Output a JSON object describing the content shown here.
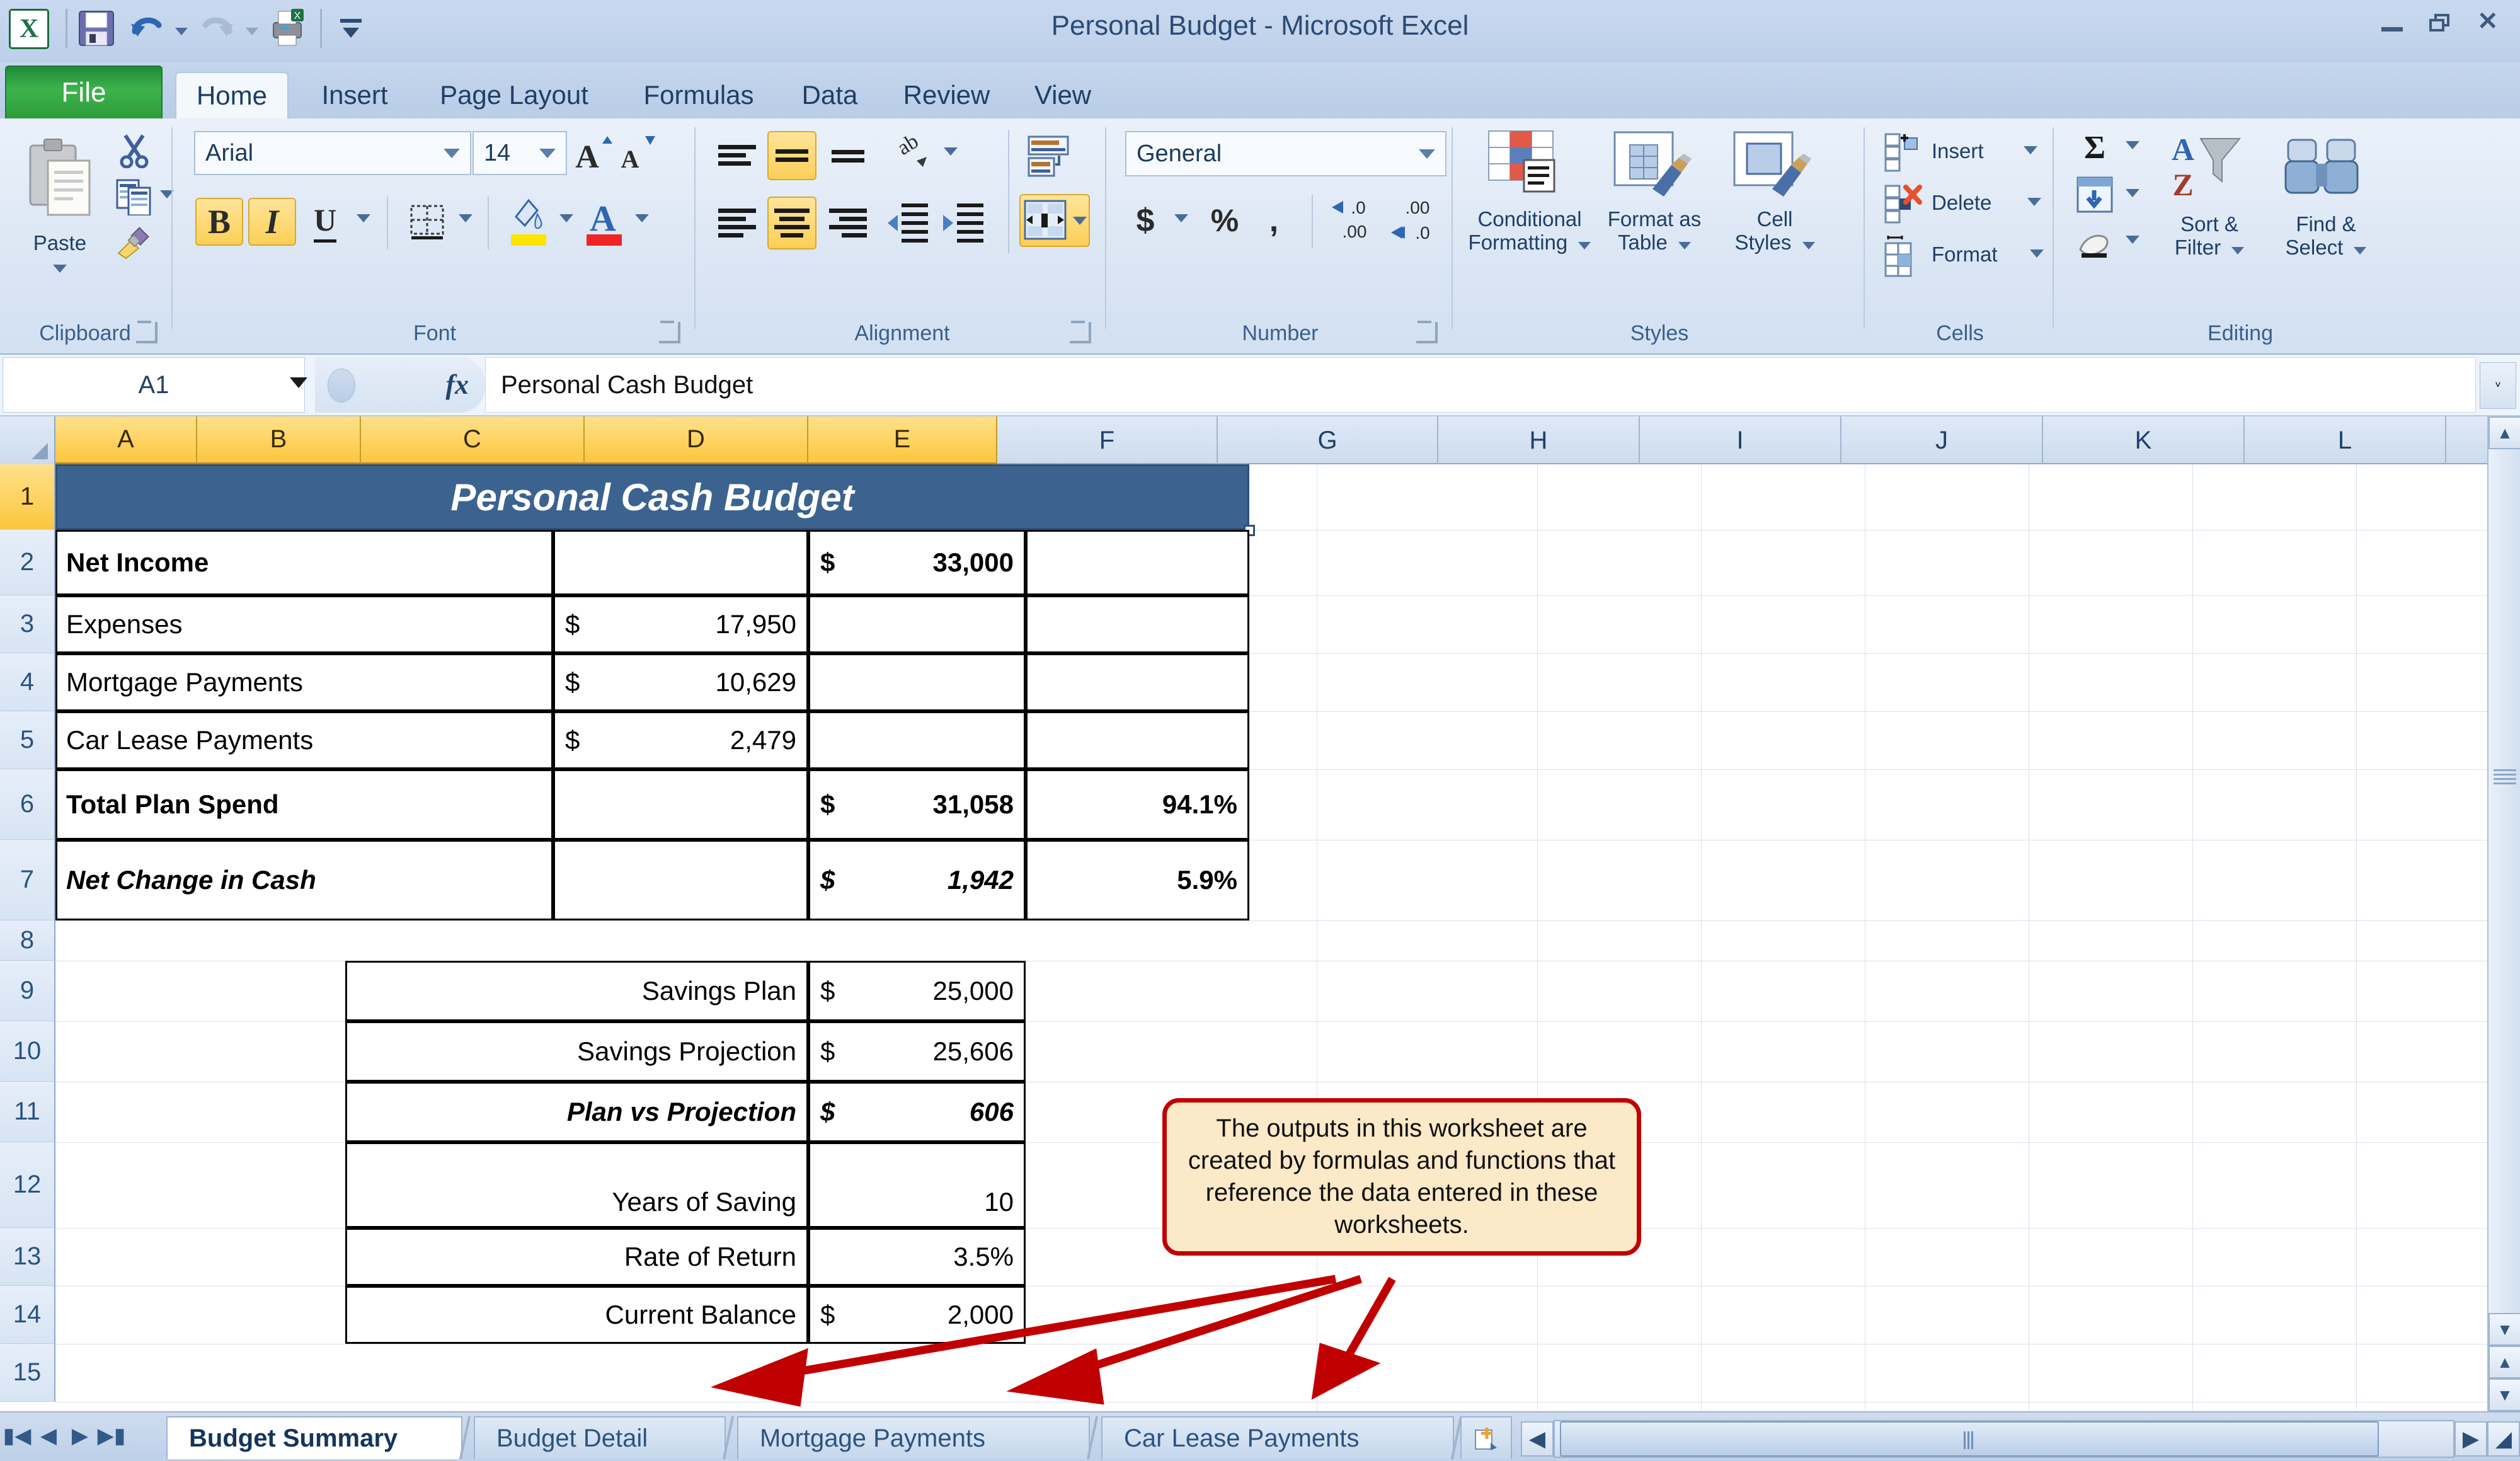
{
  "window": {
    "title": "Personal Budget  -  Microsoft Excel",
    "minimize_label": "–",
    "restore_label": "❐",
    "close_label": "✕",
    "ribbon_collapse_label": "▲",
    "help_label": "?"
  },
  "quick_access": {
    "items": [
      {
        "name": "save-icon",
        "label": "Save"
      },
      {
        "name": "undo-icon",
        "label": "Undo"
      },
      {
        "name": "redo-icon",
        "label": "Redo"
      },
      {
        "name": "print-preview-icon",
        "label": "Print Preview and Print"
      },
      {
        "name": "customize-qat-icon",
        "label": "Customize Quick Access Toolbar"
      }
    ]
  },
  "ribbon": {
    "file_tab": "File",
    "tabs": [
      {
        "label": "Home",
        "active": true
      },
      {
        "label": "Insert",
        "active": false
      },
      {
        "label": "Page Layout",
        "active": false
      },
      {
        "label": "Formulas",
        "active": false
      },
      {
        "label": "Data",
        "active": false
      },
      {
        "label": "Review",
        "active": false
      },
      {
        "label": "View",
        "active": false
      }
    ],
    "groups": {
      "clipboard": {
        "label": "Clipboard",
        "paste_label": "Paste",
        "cut_label": "Cut",
        "copy_label": "Copy",
        "format_painter_label": "Format Painter"
      },
      "font": {
        "label": "Font",
        "font_name": "Arial",
        "font_size": "14",
        "grow_font_label": "A",
        "shrink_font_label": "A",
        "bold_label": "B",
        "bold_active": true,
        "italic_label": "I",
        "italic_active": true,
        "underline_label": "U",
        "borders_label": "Borders",
        "fill_color_label": "Fill Color",
        "font_color_label": "Font Color"
      },
      "alignment": {
        "label": "Alignment",
        "top_align_label": "Top Align",
        "middle_align_label": "Middle Align",
        "middle_align_active": true,
        "bottom_align_label": "Bottom Align",
        "orientation_label": "Orientation",
        "align_left_label": "Align Text Left",
        "align_center_label": "Center",
        "align_center_active": true,
        "align_right_label": "Align Text Right",
        "decrease_indent_label": "Decrease Indent",
        "increase_indent_label": "Increase Indent",
        "wrap_text_label": "Wrap Text",
        "merge_center_label": "Merge & Center",
        "merge_center_active": true
      },
      "number": {
        "label": "Number",
        "format": "General",
        "accounting_label": "$",
        "percent_label": "%",
        "comma_label": ",",
        "increase_decimal_label": ".00",
        "decrease_decimal_label": ".0"
      },
      "styles": {
        "label": "Styles",
        "conditional_formatting_label": "Conditional\nFormatting",
        "conditional_formatting_line1": "Conditional",
        "conditional_formatting_line2": "Formatting",
        "format_as_table_line1": "Format as",
        "format_as_table_line2": "Table",
        "cell_styles_line1": "Cell",
        "cell_styles_line2": "Styles"
      },
      "cells": {
        "label": "Cells",
        "insert_label": "Insert",
        "delete_label": "Delete",
        "format_label": "Format"
      },
      "editing": {
        "label": "Editing",
        "autosum_label": "Σ",
        "fill_label": "Fill",
        "clear_label": "Clear",
        "sort_filter_line1": "Sort &",
        "sort_filter_line2": "Filter",
        "find_select_line1": "Find &",
        "find_select_line2": "Select"
      }
    }
  },
  "formula_bar": {
    "name_box": "A1",
    "fx_label": "fx",
    "formula_value": "Personal Cash Budget",
    "expand_label": "˅"
  },
  "grid": {
    "columns": [
      "A",
      "B",
      "C",
      "D",
      "E",
      "F",
      "G",
      "H",
      "I",
      "J",
      "K",
      "L"
    ],
    "selected_columns": [
      "A",
      "B",
      "C",
      "D",
      "E"
    ],
    "rows": [
      "1",
      "2",
      "3",
      "4",
      "5",
      "6",
      "7",
      "8",
      "9",
      "10",
      "11",
      "12",
      "13",
      "14",
      "15"
    ],
    "selected_rows": [
      "1"
    ],
    "merged_title": "Personal Cash Budget",
    "budget_rows": [
      {
        "row": "2",
        "label": "Net Income",
        "bold": true,
        "italic": false,
        "c_sym": "",
        "c_val": "",
        "d_sym": "$",
        "d_val": "33,000",
        "e_val": ""
      },
      {
        "row": "3",
        "label": "Expenses",
        "bold": false,
        "italic": false,
        "c_sym": "$",
        "c_val": "17,950",
        "d_sym": "",
        "d_val": "",
        "e_val": ""
      },
      {
        "row": "4",
        "label": "Mortgage Payments",
        "bold": false,
        "italic": false,
        "c_sym": "$",
        "c_val": "10,629",
        "d_sym": "",
        "d_val": "",
        "e_val": ""
      },
      {
        "row": "5",
        "label": "Car Lease Payments",
        "bold": false,
        "italic": false,
        "c_sym": "$",
        "c_val": "2,479",
        "d_sym": "",
        "d_val": "",
        "e_val": ""
      },
      {
        "row": "6",
        "label": "Total Plan Spend",
        "bold": true,
        "italic": false,
        "c_sym": "",
        "c_val": "",
        "d_sym": "$",
        "d_val": "31,058",
        "e_val": "94.1%"
      },
      {
        "row": "7",
        "label": "Net Change in Cash",
        "bold": true,
        "italic": true,
        "c_sym": "",
        "c_val": "",
        "d_sym": "$",
        "d_val": "1,942",
        "e_val": "5.9%"
      }
    ],
    "savings_rows": [
      {
        "row": "9",
        "label": "Savings Plan",
        "bold": false,
        "italic": false,
        "sym": "$",
        "value": "25,000"
      },
      {
        "row": "10",
        "label": "Savings Projection",
        "bold": false,
        "italic": false,
        "sym": "$",
        "value": "25,606"
      },
      {
        "row": "11",
        "label": "Plan vs Projection",
        "bold": true,
        "italic": true,
        "sym": "$",
        "value": "606"
      },
      {
        "row": "12",
        "label": "Years of Saving",
        "bold": false,
        "italic": false,
        "sym": "",
        "value": "10"
      },
      {
        "row": "13",
        "label": "Rate of Return",
        "bold": false,
        "italic": false,
        "sym": "",
        "value": "3.5%"
      },
      {
        "row": "14",
        "label": "Current Balance",
        "bold": false,
        "italic": false,
        "sym": "$",
        "value": "2,000"
      }
    ]
  },
  "callout": {
    "text": "The outputs in this worksheet are created by formulas and functions that reference the data entered in these worksheets.",
    "border_color": "#c00000",
    "fill_color": "#fce9c7",
    "arrow_color": "#c00000"
  },
  "sheet_tabs": {
    "tabs": [
      {
        "label": "Budget Summary",
        "active": true
      },
      {
        "label": "Budget Detail",
        "active": false
      },
      {
        "label": "Mortgage Payments",
        "active": false
      },
      {
        "label": "Car Lease Payments",
        "active": false
      }
    ],
    "insert_sheet_label": "✳",
    "nav_first": "⏮",
    "nav_prev": "◀",
    "nav_next": "▶",
    "nav_last": "⏭",
    "scroll_left": "◀",
    "scroll_right": "▶"
  },
  "colors": {
    "title_fill": "#3c6390",
    "selected_header": "#fcc63f",
    "accent": "#2c4b73"
  }
}
